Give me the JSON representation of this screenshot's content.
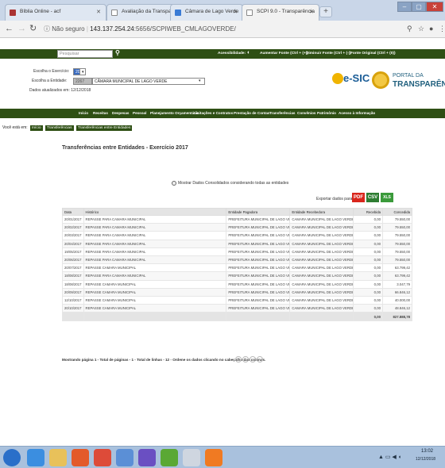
{
  "browser": {
    "tabs": [
      {
        "label": "Bíblia Online - acf"
      },
      {
        "label": "Avaliação da Transparência dos"
      },
      {
        "label": "Câmara de Lago Verde"
      },
      {
        "label": "SCPI 9.0 - Transparência"
      }
    ],
    "security_label": "Não seguro",
    "url_host": "143.137.254.24",
    "url_path": ":5656/SCPIWEB_CMLAGOVERDE/"
  },
  "header": {
    "search_placeholder": "Pesquisar",
    "accessibility": "Acessibilidade:",
    "font_up": "Aumentar Fonte (Ctrl + (+))",
    "font_down": "Diminuir Fonte (Ctrl + (-))",
    "font_orig": "Fonte Original (Ctrl + (0))",
    "exercise_label": "Escolha o Exercício:",
    "exercise_value": "2017",
    "entity_label": "Escolha a Entidade:",
    "entity_code": "2267",
    "entity_value": "CÂMARA MUNICIPAL DE LAGO VERDE",
    "updated": "Dados atualizados em: 12/12/2018",
    "esic": "e-SIC",
    "portal_line1": "PORTAL DA",
    "portal_line2": "TRANSPARÊNCIA"
  },
  "menu": [
    "Início",
    "Receitas",
    "Despesas",
    "Pessoal",
    "Planejamento Orçamentário",
    "Licitações e Contratos",
    "Prestação de Contas",
    "Transferências",
    "Convênios",
    "Patrimônio",
    "Acesso à Informação"
  ],
  "breadcrumb": {
    "label": "Você está em:",
    "items": [
      "Início",
      "Transferências",
      "Transferências entre Entidades"
    ]
  },
  "page": {
    "title": "Transferências entre Entidades - Exercício 2017",
    "checkbox_label": "Mostrar Dados Consolidados considerando todas as entidades",
    "export_label": "Exportar dados para:",
    "export_pdf": "PDF",
    "export_csv": "CSV",
    "export_xls": "XLS"
  },
  "table": {
    "headers": [
      "Data",
      "Histórico",
      "Entidade Pagadora",
      "Entidade Recebedora",
      "Recebida",
      "Concedida"
    ],
    "rows": [
      [
        "20/01/2017",
        "REPASSE PARA CAMARA MUNICIPAL",
        "PREFEITURA MUNICIPAL DE LAGO VERDE",
        "CAMARA MUNICIPAL DE LAGO VERDE",
        "0,00",
        "79.550,00"
      ],
      [
        "20/02/2017",
        "REPASSE PARA CAMARA MUNICIPAL",
        "PREFEITURA MUNICIPAL DE LAGO VERDE",
        "CAMARA MUNICIPAL DE LAGO VERDE",
        "0,00",
        "79.550,00"
      ],
      [
        "20/03/2017",
        "REPASSE PARA CAMARA MUNICIPAL",
        "PREFEITURA MUNICIPAL DE LAGO VERDE",
        "CAMARA MUNICIPAL DE LAGO VERDE",
        "0,00",
        "79.550,00"
      ],
      [
        "20/04/2017",
        "REPASSE PARA CAMARA MUNICIPAL",
        "PREFEITURA MUNICIPAL DE LAGO VERDE",
        "CAMARA MUNICIPAL DE LAGO VERDE",
        "0,00",
        "79.550,00"
      ],
      [
        "19/05/2017",
        "REPASSE PARA CAMARA MUNICIPAL",
        "PREFEITURA MUNICIPAL DE LAGO VERDE",
        "CAMARA MUNICIPAL DE LAGO VERDE",
        "0,00",
        "79.550,00"
      ],
      [
        "20/06/2017",
        "REPASSE PARA CAMARA MUNICIPAL",
        "PREFEITURA MUNICIPAL DE LAGO VERDE",
        "CAMARA MUNICIPAL DE LAGO VERDE",
        "0,00",
        "79.550,00"
      ],
      [
        "20/07/2017",
        "REPASSE CAMARA MUNICIPAL",
        "PREFEITURA MUNICIPAL DE LAGO VERDE",
        "CAMARA MUNICIPAL DE LAGO VERDE",
        "0,00",
        "63.799,42"
      ],
      [
        "18/08/2017",
        "REPASSE PARA CAMARA MUNICIPAL",
        "PREFEITURA MUNICIPAL DE LAGO VERDE",
        "CAMARA MUNICIPAL DE LAGO VERDE",
        "0,00",
        "63.799,42"
      ],
      [
        "18/08/2017",
        "REPASSE CAMARA MUNICIPAL",
        "PREFEITURA MUNICIPAL DE LAGO VERDE",
        "CAMARA MUNICIPAL DE LAGO VERDE",
        "0,00",
        "3.047,79"
      ],
      [
        "20/09/2017",
        "REPASSE CAMARA MUNICIPAL",
        "PREFEITURA MUNICIPAL DE LAGO VERDE",
        "CAMARA MUNICIPAL DE LAGO VERDE",
        "0,00",
        "66.846,12"
      ],
      [
        "12/10/2017",
        "REPASSE CAMARA MUNICIPAL",
        "PREFEITURA MUNICIPAL DE LAGO VERDE",
        "CAMARA MUNICIPAL DE LAGO VERDE",
        "0,00",
        "40.000,00"
      ],
      [
        "20/10/2017",
        "REPASSE CAMARA MUNICIPAL",
        "PREFEITURA MUNICIPAL DE LAGO VERDE",
        "CAMARA MUNICIPAL DE LAGO VERDE",
        "0,00",
        "48.846,12"
      ]
    ],
    "total_recebida": "0,00",
    "total_concedida": "827.888,78"
  },
  "pager": {
    "status": "Mostrando página 1 - Total de páginas - 1 - Total de linhas - 12 - Ordene os dados clicando no cabeçalho das colunas."
  },
  "taskbar": {
    "time": "13:02",
    "date": "12/12/2018"
  },
  "colors": {
    "brand_green": "#2e4f14",
    "pdf": "#d9261c",
    "csv": "#2e7d32",
    "xls": "#3a9a3a"
  }
}
